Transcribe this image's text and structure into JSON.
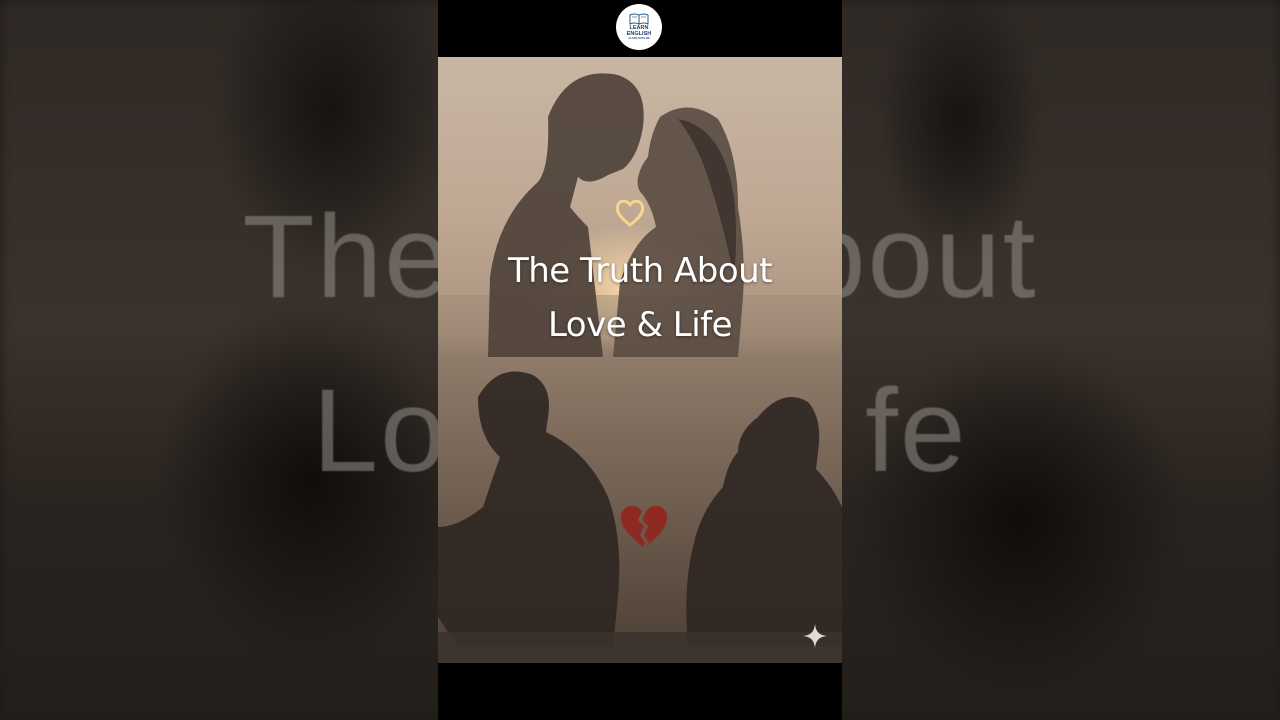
{
  "logo": {
    "line1": "LEARN ENGLISH",
    "line2": "ALONG WITH ME",
    "icon": "open-book-icon"
  },
  "video": {
    "title_line1": "The Truth About",
    "title_line2": "Love & Life",
    "icons": {
      "top_heart": "heart-icon",
      "bottom_heart": "broken-heart-icon",
      "corner": "sparkle-icon"
    },
    "colors": {
      "top_heart": "#f6d68a",
      "broken_heart": "#8e2a22"
    }
  },
  "background": {
    "line1": "The T       bout",
    "line2": "Lo            fe"
  }
}
